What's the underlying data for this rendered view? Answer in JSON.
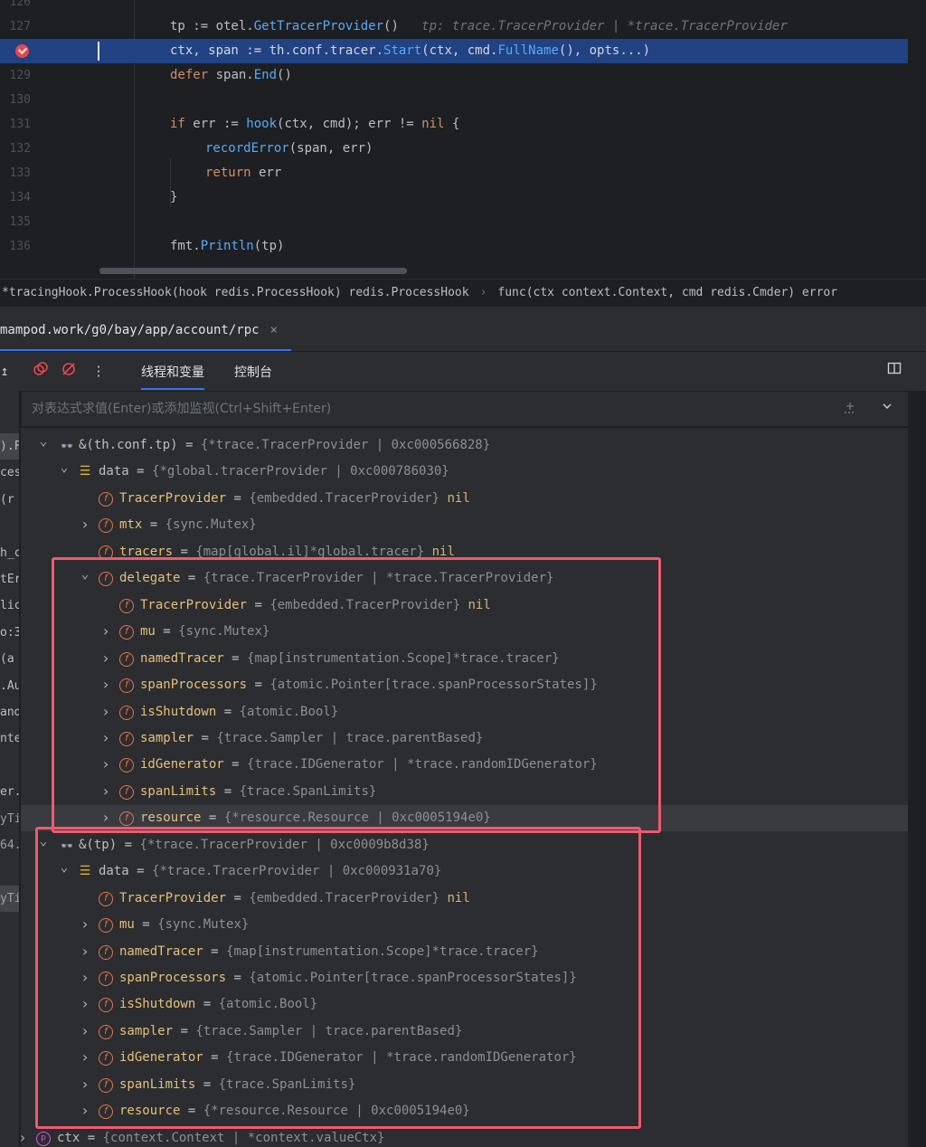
{
  "editor": {
    "lines": [
      {
        "n": "126",
        "code": ""
      },
      {
        "n": "127",
        "code": "tp := otel.GetTracerProvider()",
        "hint": "tp: trace.TracerProvider | *trace.TracerProvider"
      },
      {
        "n": "",
        "code": "ctx, span := th.conf.tracer.Start(ctx, cmd.FullName(), opts...)",
        "active": true,
        "breakpoint": true
      },
      {
        "n": "129",
        "code": "defer span.End()"
      },
      {
        "n": "130",
        "code": ""
      },
      {
        "n": "131",
        "code": "if err := hook(ctx, cmd); err != nil {"
      },
      {
        "n": "132",
        "code": "recordError(span, err)",
        "indent": true
      },
      {
        "n": "133",
        "code": "return err",
        "indent": true
      },
      {
        "n": "134",
        "code": "}"
      },
      {
        "n": "135",
        "code": ""
      },
      {
        "n": "136",
        "code": "fmt.Println(tp)"
      }
    ]
  },
  "breadcrumb": {
    "items": [
      "*tracingHook.ProcessHook(hook redis.ProcessHook) redis.ProcessHook",
      "func(ctx context.Context, cmd redis.Cmder) error"
    ],
    "separator": "›"
  },
  "session": {
    "tab_label": "mampod.work/g0/bay/app/account/rpc",
    "close": "×"
  },
  "toolbar": {
    "tab_threads": "线程和变量",
    "tab_console": "控制台",
    "icons": [
      "step-out-icon",
      "rerun-icon",
      "mute-breakpoints-icon",
      "more-icon",
      "layout-icon"
    ]
  },
  "expression": {
    "placeholder": "对表达式求值(Enter)或添加监视(Ctrl+Shift+Enter)"
  },
  "frames": [
    ").F",
    "ces",
    "(r",
    "",
    "h_c",
    "tEr",
    "lic",
    "o:3",
    "(a",
    ".Au",
    "and",
    "nte",
    "",
    "er.",
    "yTi",
    "64.",
    "",
    "yTi"
  ],
  "variables": [
    {
      "depth": 0,
      "arrow": "down",
      "icon": "watch",
      "name": "&(th.conf.tp)",
      "plain": true,
      "value": "{*trace.TracerProvider | 0xc000566828}"
    },
    {
      "depth": 1,
      "arrow": "down",
      "icon": "obj",
      "name": "data",
      "plain": true,
      "value": "{*global.tracerProvider | 0xc000786030}"
    },
    {
      "depth": 2,
      "arrow": "",
      "icon": "field",
      "name": "TracerProvider",
      "value": "{embedded.TracerProvider}",
      "nil": "nil"
    },
    {
      "depth": 2,
      "arrow": "right",
      "icon": "field",
      "name": "mtx",
      "value": "{sync.Mutex}"
    },
    {
      "depth": 2,
      "arrow": "",
      "icon": "field",
      "name": "tracers",
      "value": "{map[global.il]*global.tracer}",
      "nil": "nil"
    },
    {
      "depth": 2,
      "arrow": "down",
      "icon": "field",
      "name": "delegate",
      "value": "{trace.TracerProvider | *trace.TracerProvider}"
    },
    {
      "depth": 3,
      "arrow": "",
      "icon": "field",
      "name": "TracerProvider",
      "value": "{embedded.TracerProvider}",
      "nil": "nil"
    },
    {
      "depth": 3,
      "arrow": "right",
      "icon": "field",
      "name": "mu",
      "value": "{sync.Mutex}"
    },
    {
      "depth": 3,
      "arrow": "right",
      "icon": "field",
      "name": "namedTracer",
      "value": "{map[instrumentation.Scope]*trace.tracer}"
    },
    {
      "depth": 3,
      "arrow": "right",
      "icon": "field",
      "name": "spanProcessors",
      "value": "{atomic.Pointer[trace.spanProcessorStates]}"
    },
    {
      "depth": 3,
      "arrow": "right",
      "icon": "field",
      "name": "isShutdown",
      "value": "{atomic.Bool}"
    },
    {
      "depth": 3,
      "arrow": "right",
      "icon": "field",
      "name": "sampler",
      "value": "{trace.Sampler | trace.parentBased}"
    },
    {
      "depth": 3,
      "arrow": "right",
      "icon": "field",
      "name": "idGenerator",
      "value": "{trace.IDGenerator | *trace.randomIDGenerator}"
    },
    {
      "depth": 3,
      "arrow": "right",
      "icon": "field",
      "name": "spanLimits",
      "value": "{trace.SpanLimits}"
    },
    {
      "depth": 3,
      "arrow": "right",
      "icon": "field",
      "name": "resource",
      "value": "{*resource.Resource | 0xc0005194e0}",
      "highlight": true
    },
    {
      "depth": 0,
      "arrow": "down",
      "icon": "watch",
      "name": "&(tp)",
      "plain": true,
      "value": "{*trace.TracerProvider | 0xc0009b8d38}"
    },
    {
      "depth": 1,
      "arrow": "down",
      "icon": "obj",
      "name": "data",
      "plain": true,
      "value": "{*trace.TracerProvider | 0xc000931a70}"
    },
    {
      "depth": 2,
      "arrow": "",
      "icon": "field",
      "name": "TracerProvider",
      "value": "{embedded.TracerProvider}",
      "nil": "nil"
    },
    {
      "depth": 2,
      "arrow": "right",
      "icon": "field",
      "name": "mu",
      "value": "{sync.Mutex}"
    },
    {
      "depth": 2,
      "arrow": "right",
      "icon": "field",
      "name": "namedTracer",
      "value": "{map[instrumentation.Scope]*trace.tracer}"
    },
    {
      "depth": 2,
      "arrow": "right",
      "icon": "field",
      "name": "spanProcessors",
      "value": "{atomic.Pointer[trace.spanProcessorStates]}"
    },
    {
      "depth": 2,
      "arrow": "right",
      "icon": "field",
      "name": "isShutdown",
      "value": "{atomic.Bool}"
    },
    {
      "depth": 2,
      "arrow": "right",
      "icon": "field",
      "name": "sampler",
      "value": "{trace.Sampler | trace.parentBased}"
    },
    {
      "depth": 2,
      "arrow": "right",
      "icon": "field",
      "name": "idGenerator",
      "value": "{trace.IDGenerator | *trace.randomIDGenerator}"
    },
    {
      "depth": 2,
      "arrow": "right",
      "icon": "field",
      "name": "spanLimits",
      "value": "{trace.SpanLimits}"
    },
    {
      "depth": 2,
      "arrow": "right",
      "icon": "field",
      "name": "resource",
      "value": "{*resource.Resource | 0xc0005194e0}"
    },
    {
      "depth": -1,
      "arrow": "right",
      "icon": "param",
      "name": "ctx",
      "plain": true,
      "value": "{context.Context | *context.valueCtx}"
    }
  ],
  "colors": {
    "accent": "#3574f0",
    "annotation": "#f05a6e",
    "selection": "#214283"
  }
}
